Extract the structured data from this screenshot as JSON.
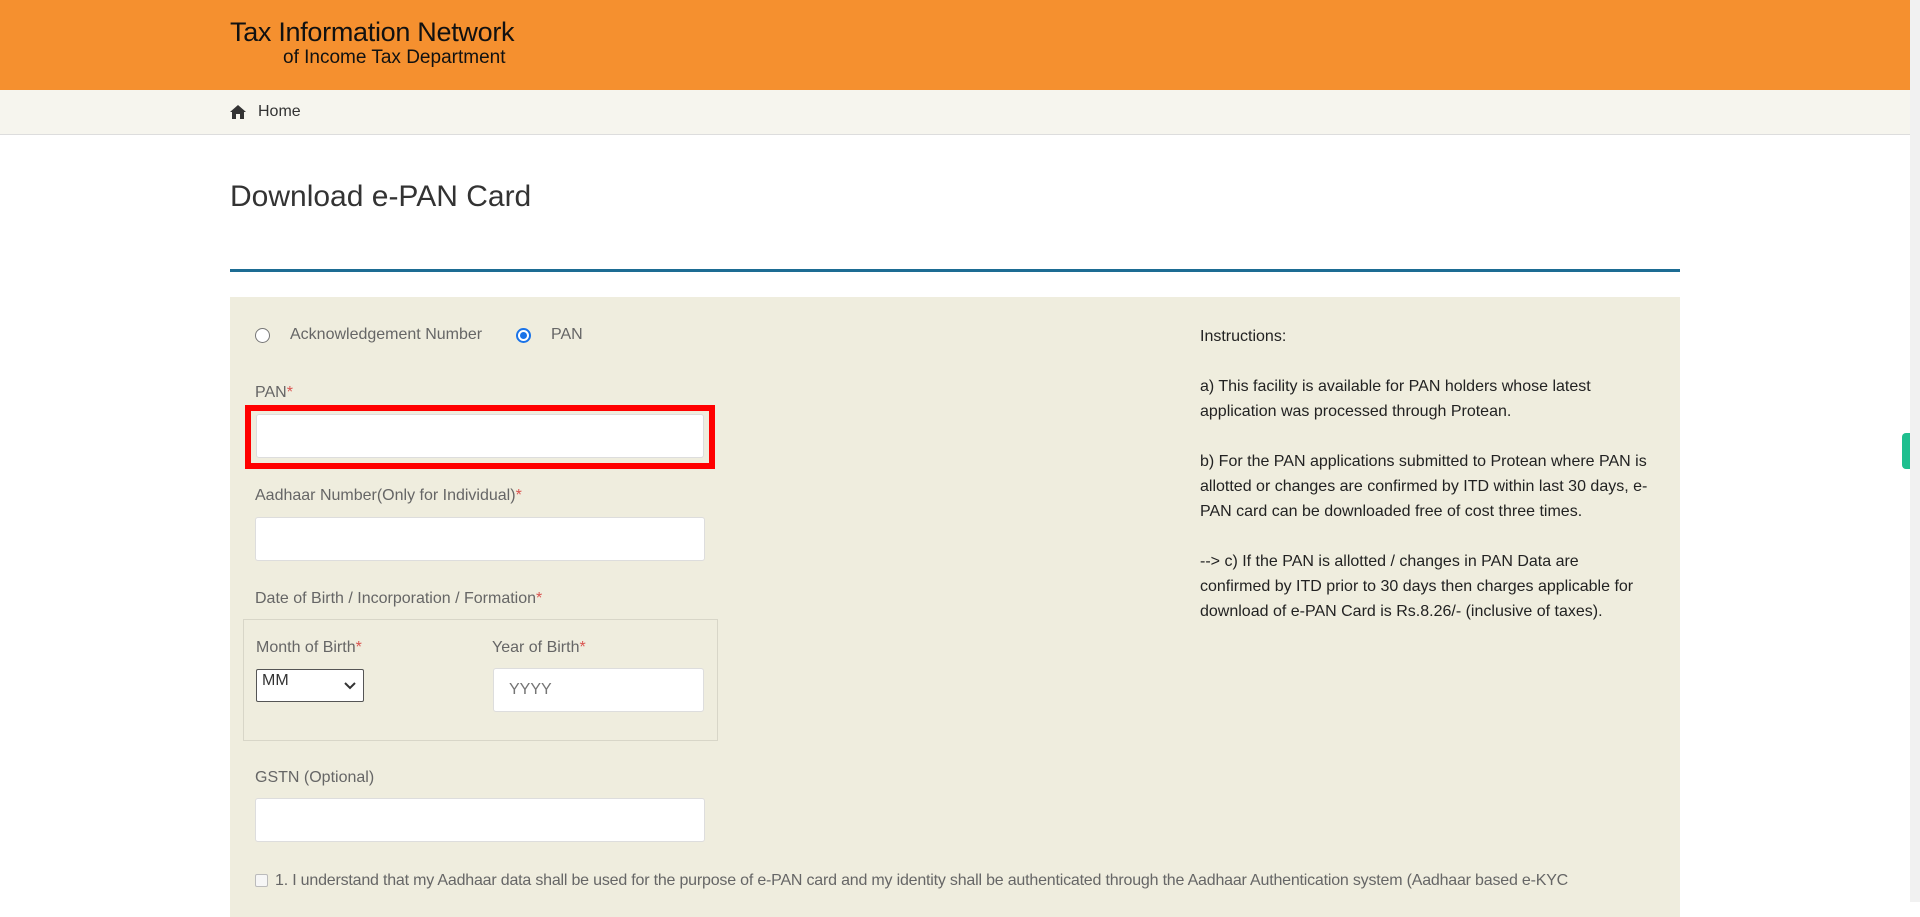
{
  "header": {
    "logo_line1": "Tax Information Network",
    "logo_line2": "of Income Tax Department",
    "brand_color": "#f5902f"
  },
  "nav": {
    "home": "Home",
    "home_icon": "home-icon"
  },
  "page_title": "Download e-PAN Card",
  "form": {
    "radio_ack": "Acknowledgement Number",
    "radio_pan": "PAN",
    "selected": "PAN",
    "pan_label": "PAN",
    "aadhaar_label": "Aadhaar Number(Only for Individual)",
    "dob_label": "Date of Birth / Incorporation / Formation",
    "month_label": "Month of Birth",
    "month_value": "MM",
    "year_label": "Year of Birth",
    "year_placeholder": "YYYY",
    "gstn_label": "GSTN (Optional)",
    "required_mark": "*",
    "consent": "1. I understand that my Aadhaar data shall be used for the purpose of e-PAN card and my identity shall be authenticated through the Aadhaar Authentication system (Aadhaar based e-KYC"
  },
  "instructions": {
    "heading": "Instructions:",
    "a": "a) This facility is available for PAN holders whose latest application was processed through Protean.",
    "b": "b) For the PAN applications submitted to Protean where PAN is allotted or changes are confirmed by ITD within last 30 days, e-PAN card can be downloaded free of cost three times.",
    "c": "--> c) If the PAN is allotted / changes in PAN Data are confirmed by ITD prior to 30 days then charges applicable for download of e-PAN Card is Rs.8.26/- (inclusive of taxes)."
  }
}
